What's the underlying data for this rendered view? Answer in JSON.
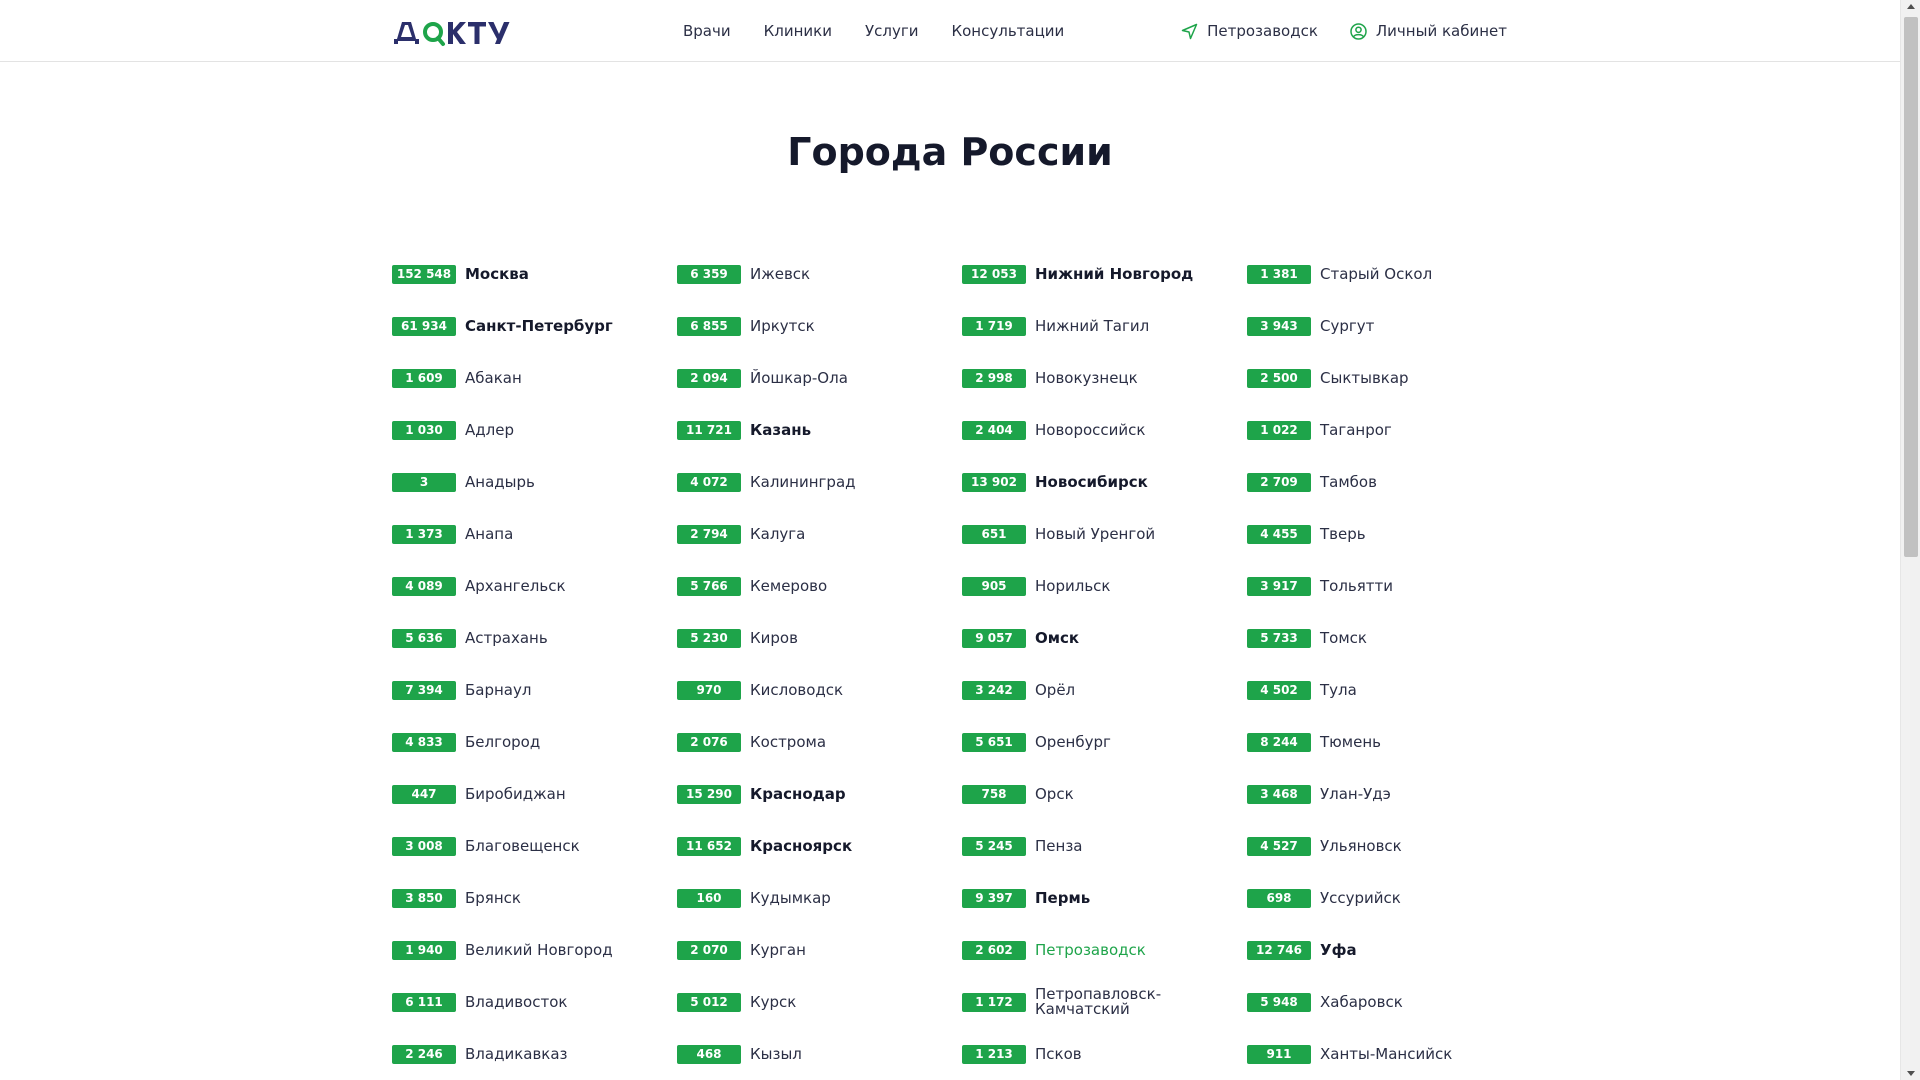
{
  "logo": {
    "text": "ДОКТУ"
  },
  "nav": {
    "items": [
      "Врачи",
      "Клиники",
      "Услуги",
      "Консультации"
    ]
  },
  "header_right": {
    "city": "Петрозаводск",
    "account": "Личный кабинет"
  },
  "page_title": "Города России",
  "cities": [
    {
      "count": "152 548",
      "name": "Москва",
      "style": "bold"
    },
    {
      "count": "61 934",
      "name": "Санкт-Петербург",
      "style": "bold"
    },
    {
      "count": "1 609",
      "name": "Абакан",
      "style": "normal"
    },
    {
      "count": "1 030",
      "name": "Адлер",
      "style": "normal"
    },
    {
      "count": "3",
      "name": "Анадырь",
      "style": "normal"
    },
    {
      "count": "1 373",
      "name": "Анапа",
      "style": "normal"
    },
    {
      "count": "4 089",
      "name": "Архангельск",
      "style": "normal"
    },
    {
      "count": "5 636",
      "name": "Астрахань",
      "style": "normal"
    },
    {
      "count": "7 394",
      "name": "Барнаул",
      "style": "normal"
    },
    {
      "count": "4 833",
      "name": "Белгород",
      "style": "normal"
    },
    {
      "count": "447",
      "name": "Биробиджан",
      "style": "normal"
    },
    {
      "count": "3 008",
      "name": "Благовещенск",
      "style": "normal"
    },
    {
      "count": "3 850",
      "name": "Брянск",
      "style": "normal"
    },
    {
      "count": "1 940",
      "name": "Великий Новгород",
      "style": "normal"
    },
    {
      "count": "6 111",
      "name": "Владивосток",
      "style": "normal"
    },
    {
      "count": "2 246",
      "name": "Владикавказ",
      "style": "normal"
    },
    {
      "count": "6 359",
      "name": "Ижевск",
      "style": "normal"
    },
    {
      "count": "6 855",
      "name": "Иркутск",
      "style": "normal"
    },
    {
      "count": "2 094",
      "name": "Йошкар-Ола",
      "style": "normal"
    },
    {
      "count": "11 721",
      "name": "Казань",
      "style": "bold"
    },
    {
      "count": "4 072",
      "name": "Калининград",
      "style": "normal"
    },
    {
      "count": "2 794",
      "name": "Калуга",
      "style": "normal"
    },
    {
      "count": "5 766",
      "name": "Кемерово",
      "style": "normal"
    },
    {
      "count": "5 230",
      "name": "Киров",
      "style": "normal"
    },
    {
      "count": "970",
      "name": "Кисловодск",
      "style": "normal"
    },
    {
      "count": "2 076",
      "name": "Кострома",
      "style": "normal"
    },
    {
      "count": "15 290",
      "name": "Краснодар",
      "style": "bold"
    },
    {
      "count": "11 652",
      "name": "Красноярск",
      "style": "bold"
    },
    {
      "count": "160",
      "name": "Кудымкар",
      "style": "normal"
    },
    {
      "count": "2 070",
      "name": "Курган",
      "style": "normal"
    },
    {
      "count": "5 012",
      "name": "Курск",
      "style": "normal"
    },
    {
      "count": "468",
      "name": "Кызыл",
      "style": "normal"
    },
    {
      "count": "12 053",
      "name": "Нижний Новгород",
      "style": "bold"
    },
    {
      "count": "1 719",
      "name": "Нижний Тагил",
      "style": "normal"
    },
    {
      "count": "2 998",
      "name": "Новокузнецк",
      "style": "normal"
    },
    {
      "count": "2 404",
      "name": "Новороссийск",
      "style": "normal"
    },
    {
      "count": "13 902",
      "name": "Новосибирск",
      "style": "bold"
    },
    {
      "count": "651",
      "name": "Новый Уренгой",
      "style": "normal"
    },
    {
      "count": "905",
      "name": "Норильск",
      "style": "normal"
    },
    {
      "count": "9 057",
      "name": "Омск",
      "style": "bold"
    },
    {
      "count": "3 242",
      "name": "Орёл",
      "style": "normal"
    },
    {
      "count": "5 651",
      "name": "Оренбург",
      "style": "normal"
    },
    {
      "count": "758",
      "name": "Орск",
      "style": "normal"
    },
    {
      "count": "5 245",
      "name": "Пенза",
      "style": "normal"
    },
    {
      "count": "9 397",
      "name": "Пермь",
      "style": "bold"
    },
    {
      "count": "2 602",
      "name": "Петрозаводск",
      "style": "active"
    },
    {
      "count": "1 172",
      "name": "Петропавловск-Камчатский",
      "style": "normal"
    },
    {
      "count": "1 213",
      "name": "Псков",
      "style": "normal"
    },
    {
      "count": "1 381",
      "name": "Старый Оскол",
      "style": "normal"
    },
    {
      "count": "3 943",
      "name": "Сургут",
      "style": "normal"
    },
    {
      "count": "2 500",
      "name": "Сыктывкар",
      "style": "normal"
    },
    {
      "count": "1 022",
      "name": "Таганрог",
      "style": "normal"
    },
    {
      "count": "2 709",
      "name": "Тамбов",
      "style": "normal"
    },
    {
      "count": "4 455",
      "name": "Тверь",
      "style": "normal"
    },
    {
      "count": "3 917",
      "name": "Тольятти",
      "style": "normal"
    },
    {
      "count": "5 733",
      "name": "Томск",
      "style": "normal"
    },
    {
      "count": "4 502",
      "name": "Тула",
      "style": "normal"
    },
    {
      "count": "8 244",
      "name": "Тюмень",
      "style": "normal"
    },
    {
      "count": "3 468",
      "name": "Улан-Удэ",
      "style": "normal"
    },
    {
      "count": "4 527",
      "name": "Ульяновск",
      "style": "normal"
    },
    {
      "count": "698",
      "name": "Уссурийск",
      "style": "normal"
    },
    {
      "count": "12 746",
      "name": "Уфа",
      "style": "bold"
    },
    {
      "count": "5 948",
      "name": "Хабаровск",
      "style": "normal"
    },
    {
      "count": "911",
      "name": "Ханты-Мансийск",
      "style": "normal"
    }
  ],
  "colors": {
    "badge": "#1ea44a",
    "text": "#2b2f45",
    "logo_dark": "#2b2f6b",
    "logo_green": "#1ea44a"
  },
  "icons": {
    "city": "navigation-arrow-icon",
    "account": "user-circle-icon"
  }
}
